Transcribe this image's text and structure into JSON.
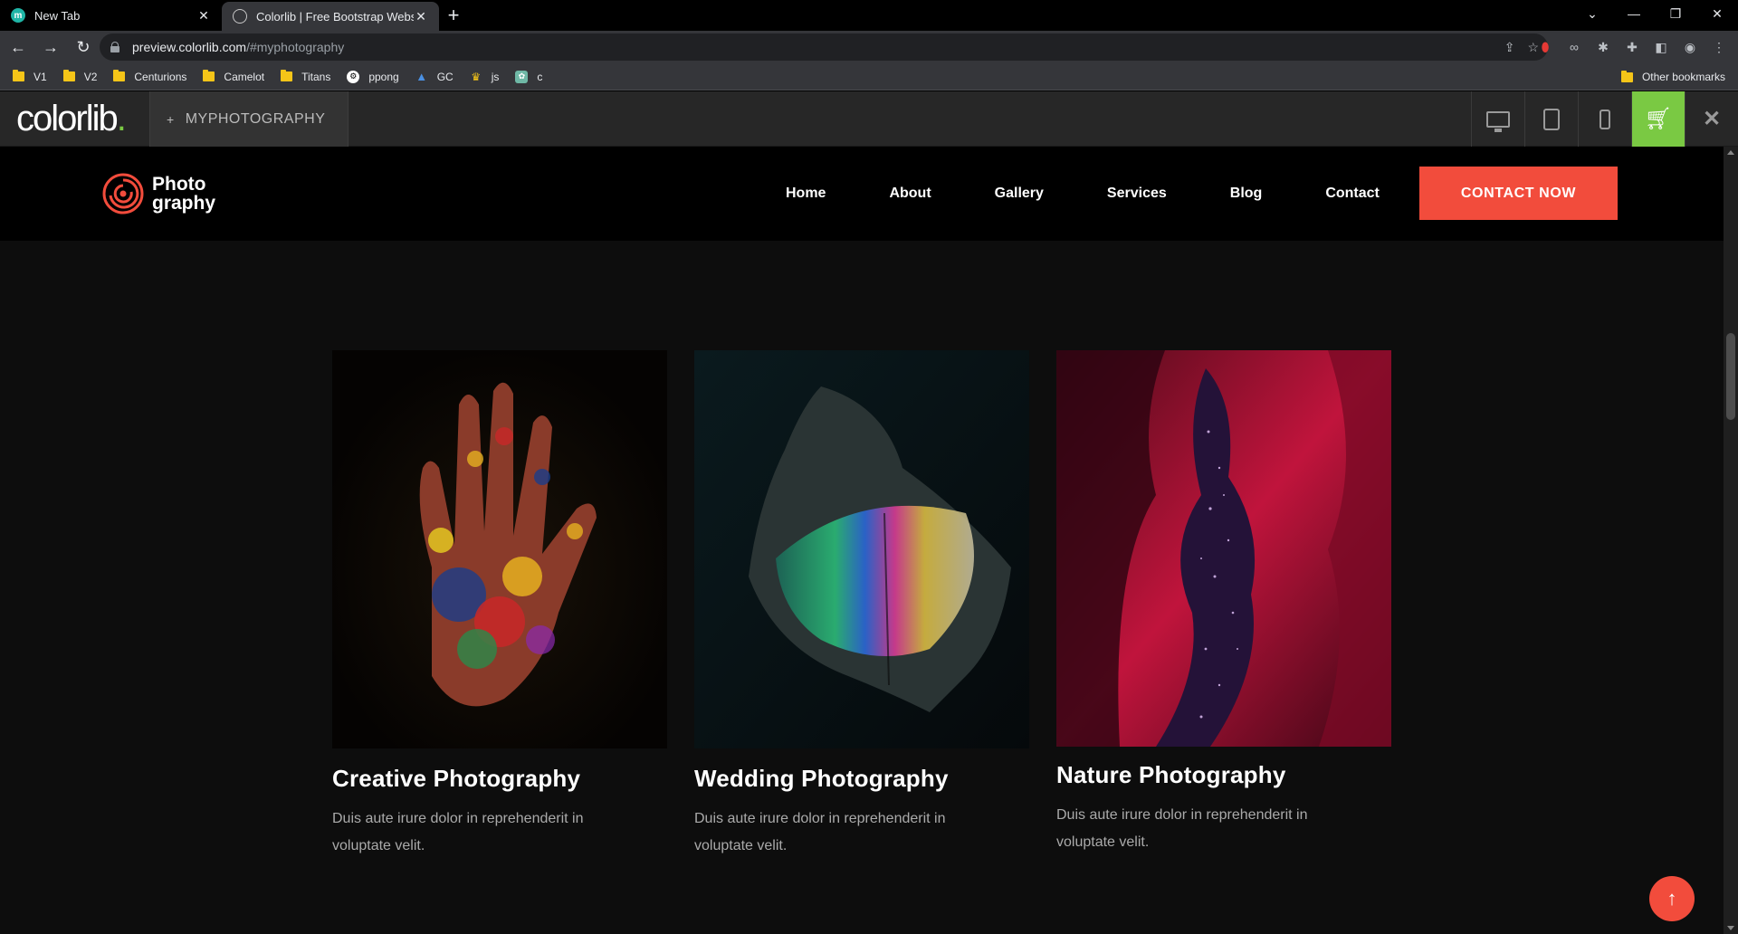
{
  "browser": {
    "tabs": [
      {
        "title": "New Tab",
        "active": false
      },
      {
        "title": "Colorlib | Free Bootstrap Website",
        "active": true
      }
    ],
    "url_host": "preview.colorlib.com",
    "url_path": "/#myphotography",
    "bookmarks": [
      "V1",
      "V2",
      "Centurions",
      "Camelot",
      "Titans",
      "ppong",
      "GC",
      "js",
      "c"
    ],
    "other_bookmarks": "Other bookmarks"
  },
  "colorlib": {
    "logo": "colorlib",
    "logo_dot": ".",
    "theme_name": "MYPHOTOGRAPHY",
    "accent": "#7ac943"
  },
  "site": {
    "brand_line1": "Photo",
    "brand_line2": "graphy",
    "nav": [
      "Home",
      "About",
      "Gallery",
      "Services",
      "Blog",
      "Contact"
    ],
    "cta": "CONTACT NOW",
    "accent": "#f24c3c",
    "cards": [
      {
        "title": "Creative Photography",
        "text": "Duis aute irure dolor in reprehenderit in voluptate velit."
      },
      {
        "title": "Wedding Photography",
        "text": "Duis aute irure dolor in reprehenderit in voluptate velit."
      },
      {
        "title": "Nature Photography",
        "text": "Duis aute irure dolor in reprehenderit in voluptate velit."
      }
    ]
  }
}
